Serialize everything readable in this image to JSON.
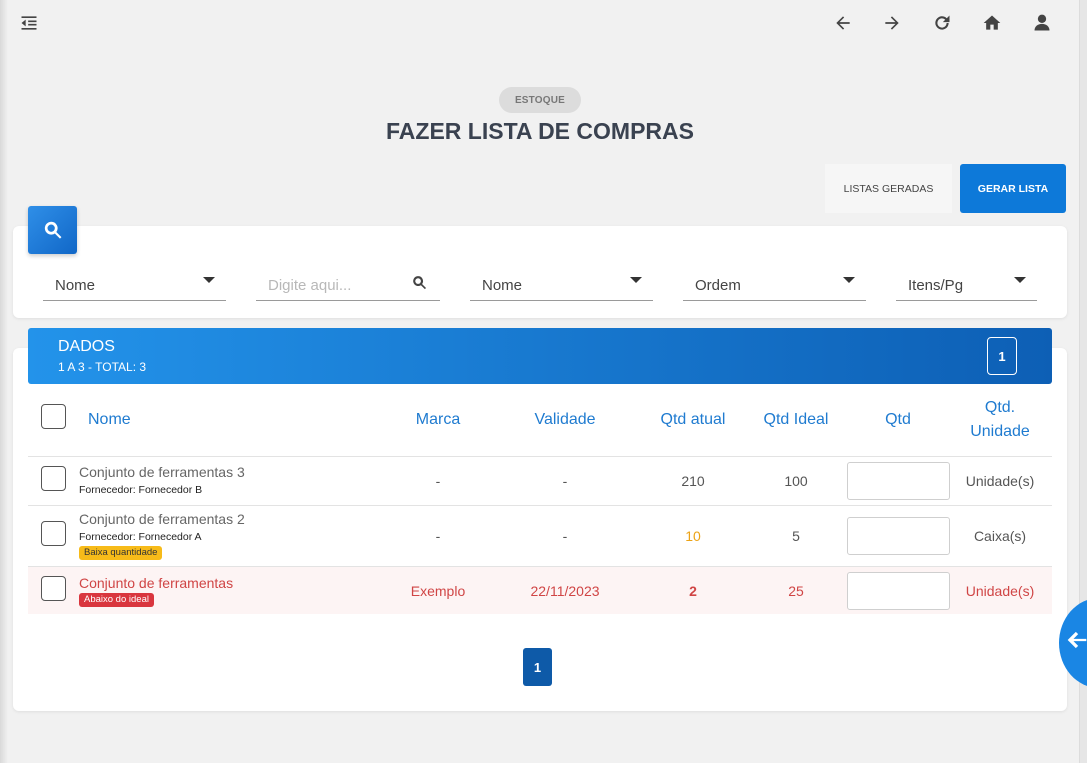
{
  "topbar": {
    "menu_icon": "menu-collapse-icon",
    "icons": [
      "arrow-left-icon",
      "arrow-right-icon",
      "refresh-icon",
      "home-icon",
      "user-icon"
    ]
  },
  "breadcrumb": "ESTOQUE",
  "page_title": "FAZER LISTA DE COMPRAS",
  "actions": {
    "secondary": "LISTAS GERADAS",
    "primary": "GERAR LISTA"
  },
  "filters": {
    "field1": "Nome",
    "search_placeholder": "Digite aqui...",
    "sort_field": "Nome",
    "order": "Ordem",
    "items_per_page": "Itens/Pg"
  },
  "data_header": {
    "title": "DADOS",
    "subtitle": "1 A 3 - TOTAL: 3",
    "page": "1"
  },
  "table": {
    "headers": {
      "nome": "Nome",
      "marca": "Marca",
      "validade": "Validade",
      "qtd_atual": "Qtd atual",
      "qtd_ideal": "Qtd Ideal",
      "qtd": "Qtd",
      "qtd_unidade": "Qtd.\nUnidade"
    },
    "rows": [
      {
        "name": "Conjunto de ferramentas 3",
        "supplier": "Fornecedor: Fornecedor B",
        "badge": "",
        "marca": "-",
        "validade": "-",
        "qtd_atual": "210",
        "qtd_ideal": "100",
        "unidade": "Unidade(s)"
      },
      {
        "name": "Conjunto de ferramentas 2",
        "supplier": "Fornecedor: Fornecedor A",
        "badge": "Baixa quantidade",
        "marca": "-",
        "validade": "-",
        "qtd_atual": "10",
        "qtd_ideal": "5",
        "unidade": "Caixa(s)"
      },
      {
        "name": "Conjunto de ferramentas",
        "supplier": "",
        "badge": "Abaixo do ideal",
        "marca": "Exemplo",
        "validade": "22/11/2023",
        "qtd_atual": "2",
        "qtd_ideal": "25",
        "unidade": "Unidade(s)"
      }
    ]
  },
  "pagination": {
    "current": "1"
  },
  "colors": {
    "primary": "#0d79d9",
    "header_text": "#1f7bd0",
    "danger": "#d9363e",
    "warning": "#f7bb19"
  }
}
